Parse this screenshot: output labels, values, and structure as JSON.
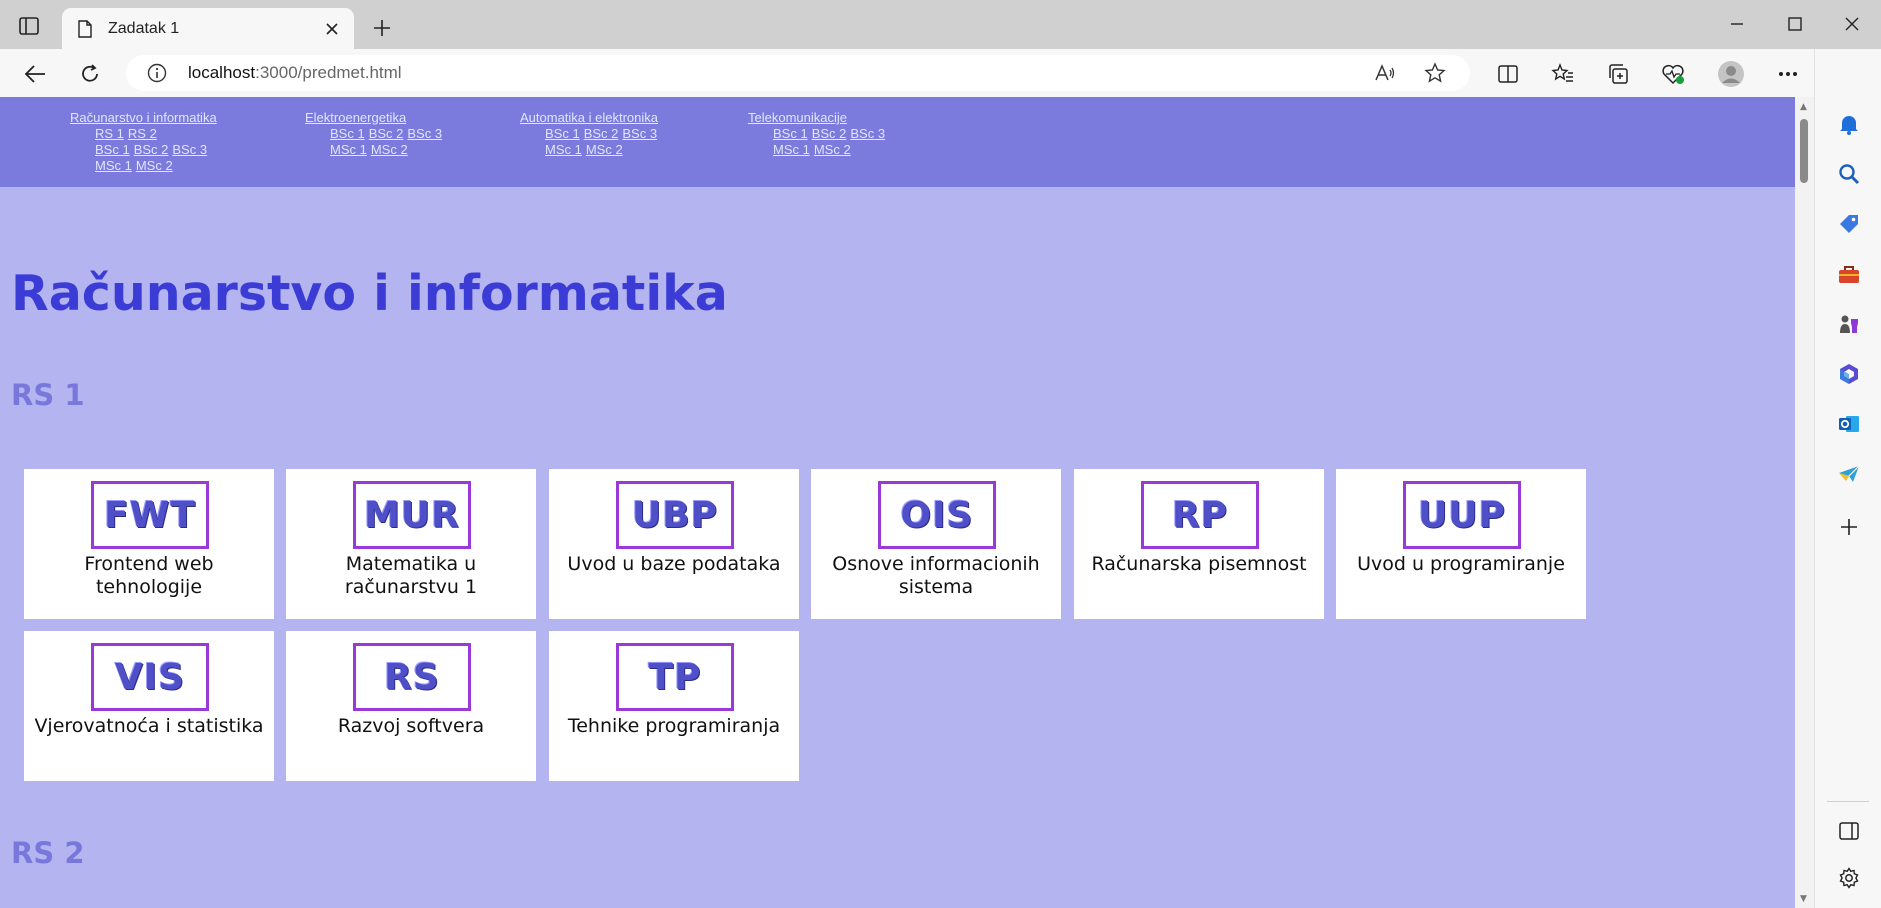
{
  "browser": {
    "tab_title": "Zadatak 1",
    "url_host": "localhost",
    "url_path": ":3000/predmet.html"
  },
  "nav": {
    "departments": [
      {
        "name": "Računarstvo i informatika",
        "rows": [
          [
            "RS 1",
            "RS 2"
          ],
          [
            "BSc 1",
            "BSc 2",
            "BSc 3"
          ],
          [
            "MSc 1",
            "MSc 2"
          ]
        ]
      },
      {
        "name": "Elektroenergetika",
        "rows": [
          [
            "BSc 1",
            "BSc 2",
            "BSc 3"
          ],
          [
            "MSc 1",
            "MSc 2"
          ]
        ]
      },
      {
        "name": "Automatika i elektronika",
        "rows": [
          [
            "BSc 1",
            "BSc 2",
            "BSc 3"
          ],
          [
            "MSc 1",
            "MSc 2"
          ]
        ]
      },
      {
        "name": "Telekomunikacije",
        "rows": [
          [
            "BSc 1",
            "BSc 2",
            "BSc 3"
          ],
          [
            "MSc 1",
            "MSc 2"
          ]
        ]
      }
    ]
  },
  "main": {
    "title": "Računarstvo i informatika",
    "sections": [
      {
        "heading": "RS 1",
        "courses": [
          {
            "code": "FWT",
            "name": "Frontend web tehnologije"
          },
          {
            "code": "MUR",
            "name": "Matematika u računarstvu 1"
          },
          {
            "code": "UBP",
            "name": "Uvod u baze podataka"
          },
          {
            "code": "OIS",
            "name": "Osnove informacionih sistema"
          },
          {
            "code": "RP",
            "name": "Računarska pisemnost"
          },
          {
            "code": "UUP",
            "name": "Uvod u programiranje"
          },
          {
            "code": "VIS",
            "name": "Vjerovatnoća i statistika"
          },
          {
            "code": "RS",
            "name": "Razvoj softvera"
          },
          {
            "code": "TP",
            "name": "Tehnike programiranja"
          }
        ]
      },
      {
        "heading": "RS 2",
        "courses": []
      }
    ]
  },
  "icons": {
    "sidebar": [
      "bell-icon",
      "search-icon",
      "tag-icon",
      "toolbox-icon",
      "games-icon",
      "microsoft365-icon",
      "outlook-icon",
      "send-icon",
      "add-icon"
    ]
  }
}
